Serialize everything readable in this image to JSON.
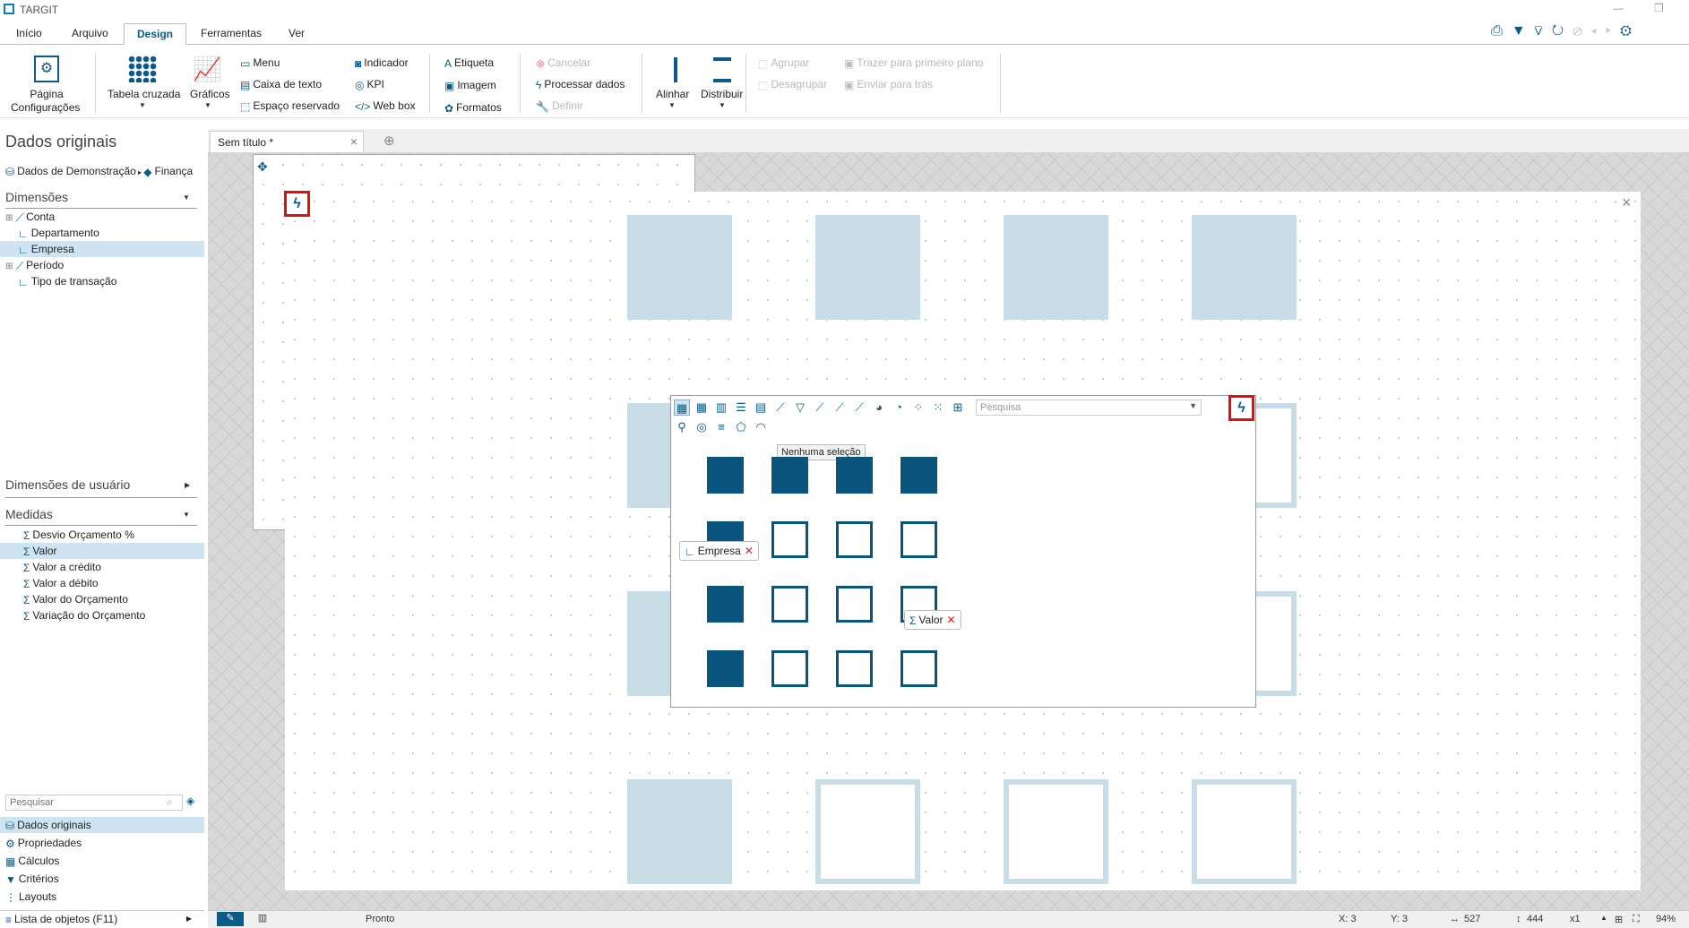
{
  "app": {
    "title": "TARGIT"
  },
  "menu": {
    "tabs": [
      "Início",
      "Arquivo",
      "Design",
      "Ferramentas",
      "Ver"
    ],
    "active": "Design"
  },
  "ribbon": {
    "page_settings": "Página\nConfigurações",
    "page_settings_l1": "Página",
    "page_settings_l2": "Configurações",
    "crosstab": "Tabela cruzada",
    "charts": "Gráficos",
    "menu": "Menu",
    "textbox": "Caixa de texto",
    "placeholder": "Espaço reservado",
    "indicator": "Indicador",
    "kpi": "KPI",
    "webbox": "Web box",
    "label": "Etiqueta",
    "image": "Imagem",
    "formats": "Formatos",
    "cancel": "Cancelar",
    "process": "Processar dados",
    "define": "Definir",
    "align": "Alinhar",
    "distribute": "Distribuir",
    "group": "Agrupar",
    "ungroup": "Desagrupar",
    "bring_front": "Trazer para primeiro plano",
    "send_back": "Enviar para trás"
  },
  "left": {
    "heading": "Dados originais",
    "breadcrumb_db": "Dados de Demonstração",
    "breadcrumb_cube": "Finança",
    "dimensions_header": "Dimensões",
    "dimensions": [
      "Conta",
      "Departamento",
      "Empresa",
      "Período",
      "Tipo de transação"
    ],
    "user_dimensions": "Dimensões de usuário",
    "measures_header": "Medidas",
    "measures": [
      "Desvio Orçamento %",
      "Valor",
      "Valor a crédito",
      "Valor a débito",
      "Valor do Orçamento",
      "Variação do Orçamento"
    ],
    "search_placeholder": "Pesquisar",
    "nav": [
      "Dados originais",
      "Propriedades",
      "Cálculos",
      "Critérios",
      "Layouts"
    ],
    "object_list": "Lista de objetos (F11)"
  },
  "document": {
    "tab": "Sem título *"
  },
  "popup": {
    "search_placeholder": "Pesquisa",
    "tooltip": "Nenhuma seleção",
    "chip_dimension": "Empresa",
    "chip_measure": "Valor"
  },
  "status": {
    "text": "Pronto",
    "x": "X: 3",
    "y": "Y: 3",
    "width": "527",
    "height": "444",
    "scale": "x1",
    "zoom": "94%"
  }
}
